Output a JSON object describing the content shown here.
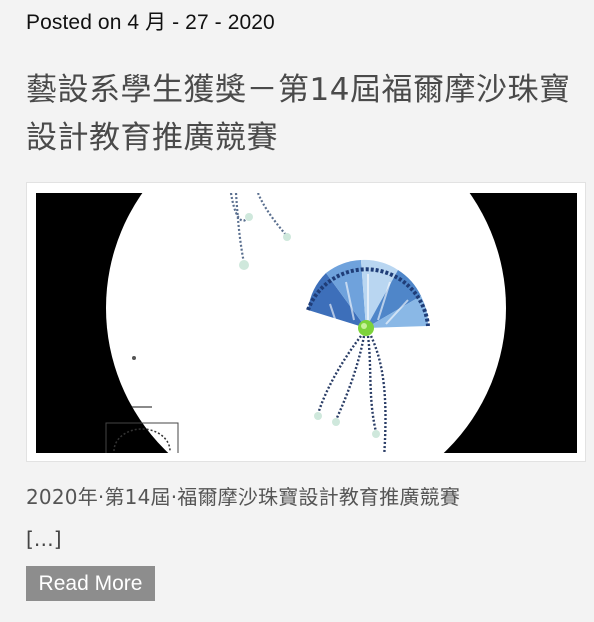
{
  "post": {
    "meta": "Posted on 4 月 - 27 - 2020",
    "title": "藝設系學生獲獎－第14屆福爾摩沙珠寶設計教育推廣競賽",
    "excerpt": "2020年·第14屆·福爾摩沙珠寶設計教育推廣競賽",
    "ellipsis": "[…]",
    "read_more_label": "Read More",
    "image": {
      "depicts": "jewelry-fan-brooch-artwork",
      "background_color": "#000000",
      "circle_color": "#ffffff",
      "gem_color": "#7dd33a",
      "fan_color": "#4a7ec8"
    }
  }
}
